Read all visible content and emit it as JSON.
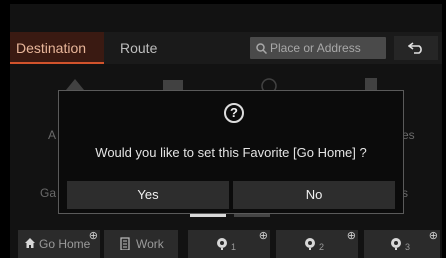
{
  "tabs": {
    "destination": "Destination",
    "route": "Route"
  },
  "search": {
    "placeholder": "Place or Address"
  },
  "background": {
    "left_labels": [
      "A",
      "Ga"
    ],
    "right_labels": [
      "es",
      "s"
    ]
  },
  "dialog": {
    "icon": "?",
    "message": "Would you like to set this Favorite [Go Home] ?",
    "yes_label": "Yes",
    "no_label": "No"
  },
  "favorites": [
    {
      "label": "Go Home",
      "icon": "home-icon"
    },
    {
      "label": "Work",
      "icon": "building-icon"
    },
    {
      "label": "1",
      "icon": "pin-star-icon"
    },
    {
      "label": "2",
      "icon": "pin-star-icon"
    },
    {
      "label": "3",
      "icon": "pin-star-icon"
    }
  ],
  "plus_symbol": "⊕",
  "colors": {
    "accent": "#d1532c",
    "background": "#121212"
  }
}
